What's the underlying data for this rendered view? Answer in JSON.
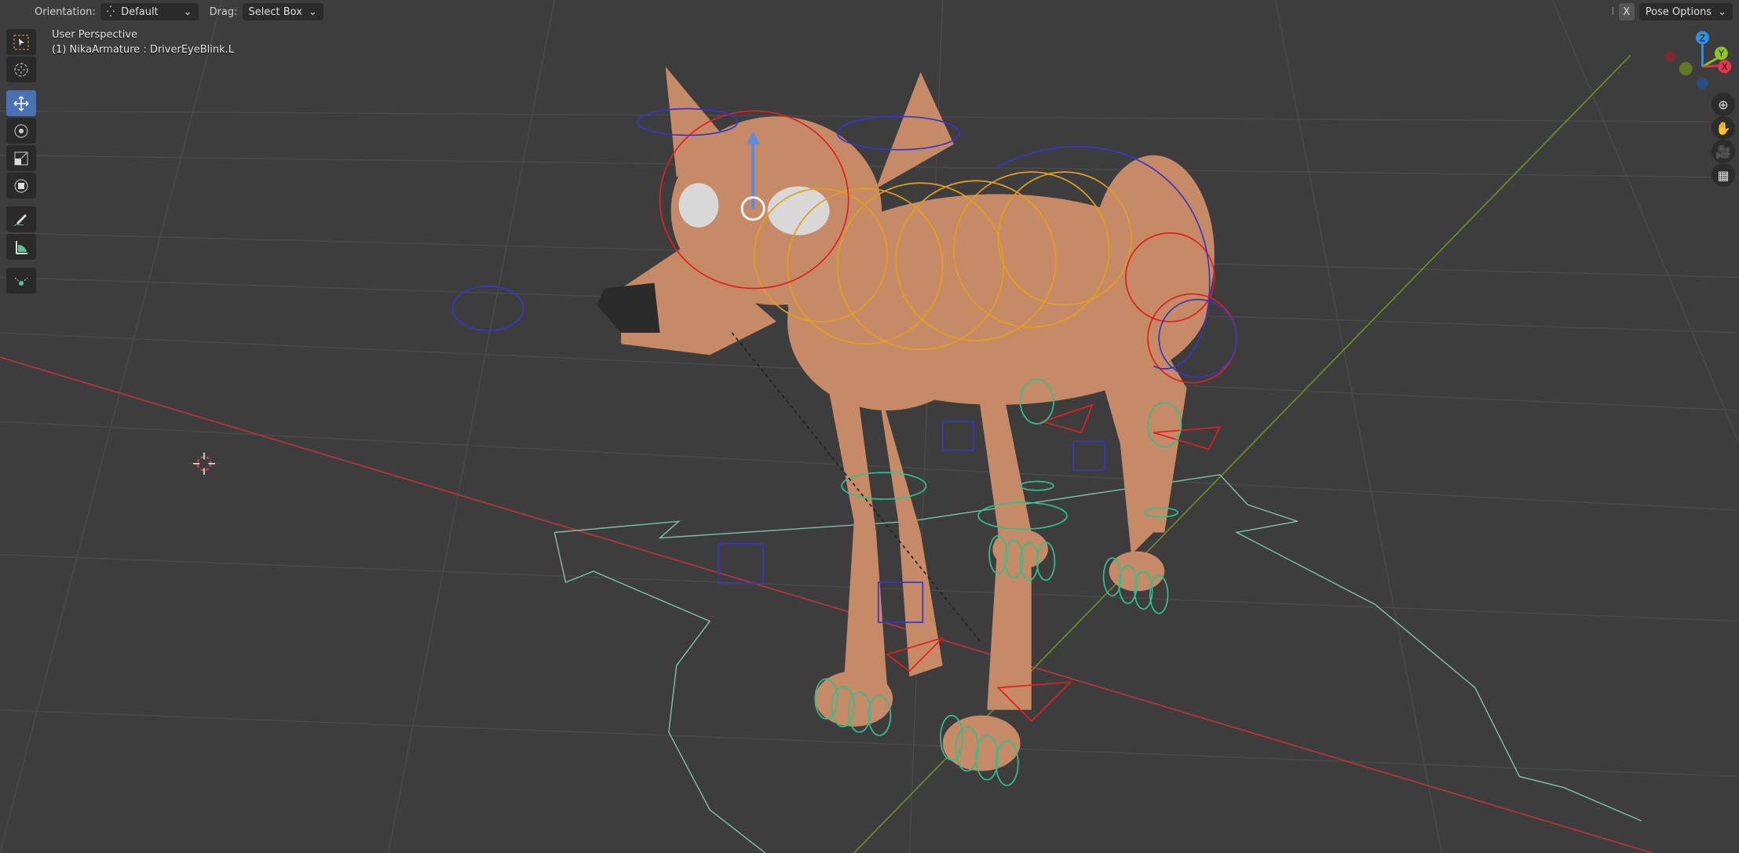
{
  "header": {
    "orientation_label": "Orientation:",
    "orientation_value": "Default",
    "drag_label": "Drag:",
    "drag_value": "Select Box",
    "mirror_x": "X",
    "pose_options": "Pose Options"
  },
  "viewport": {
    "view_name": "User Perspective",
    "active_object": "(1) NikaArmature : DriverEyeBlink.L"
  },
  "toolbar": {
    "tools": [
      "select-box",
      "cursor",
      "move",
      "rotate",
      "scale",
      "transform",
      "annotate",
      "measure",
      "pose-tool"
    ],
    "active": "move"
  },
  "gizmo": {
    "axes": [
      "X",
      "Y",
      "Z"
    ],
    "colors": {
      "x": "#e8344e",
      "y": "#8bc625",
      "z": "#2f8fee"
    }
  },
  "colors": {
    "background": "#3d3d3d",
    "accent": "#4772b3",
    "fur": "#c68a66"
  }
}
